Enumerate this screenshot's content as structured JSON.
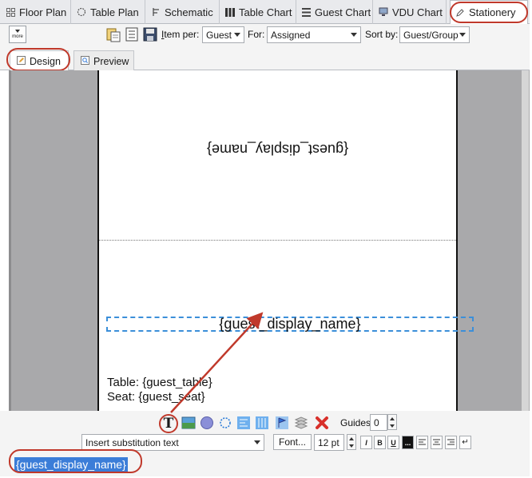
{
  "tabs": [
    {
      "label": "Floor Plan",
      "icon": "grid-icon"
    },
    {
      "label": "Table Plan",
      "icon": "ring-icon"
    },
    {
      "label": "Schematic",
      "icon": "schematic-icon"
    },
    {
      "label": "Table Chart",
      "icon": "table-chart-icon"
    },
    {
      "label": "Guest Chart",
      "icon": "guest-chart-icon"
    },
    {
      "label": "VDU Chart",
      "icon": "monitor-icon"
    },
    {
      "label": "Stationery",
      "icon": "stationery-icon",
      "active": true
    }
  ],
  "toolbar": {
    "more_label": "more",
    "item_per_label": "Item per:",
    "item_per_value": "Guest",
    "for_label": "For:",
    "for_value": "Assigned",
    "sort_by_label": "Sort by:",
    "sort_by_value": "Guest/Group"
  },
  "view_tabs": [
    {
      "label": "Design",
      "active": true
    },
    {
      "label": "Preview"
    }
  ],
  "card": {
    "top_text_flipped": "{guest_display_name}",
    "selected_field": "{guest_display_name}",
    "line_table": "Table: {guest_table}",
    "line_seat": "Seat: {guest_seat}"
  },
  "bottom_tools": {
    "guides_label": "Guides:",
    "guides_value": "0",
    "substitution_placeholder": "Insert substitution text",
    "font_button": "Font...",
    "font_size": "12 pt"
  },
  "edit_field": {
    "value": "{guest_display_name}"
  },
  "colors": {
    "highlight": "#c0392b",
    "selection": "#3b7dd8",
    "canvas_gray": "#a9a9ab"
  }
}
